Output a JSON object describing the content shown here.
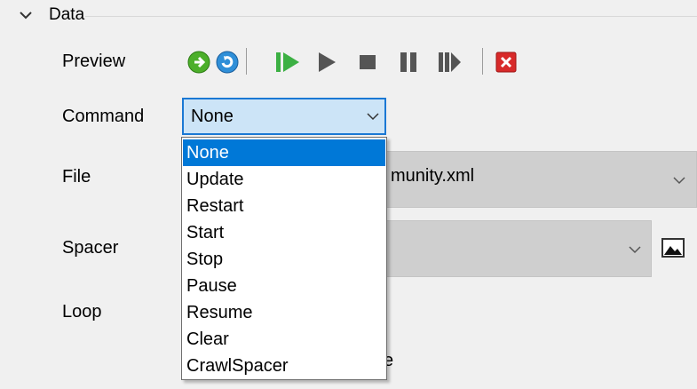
{
  "section": {
    "title": "Data",
    "expand_icon": "chevron-down-icon"
  },
  "labels": {
    "preview": "Preview",
    "command": "Command",
    "file": "File",
    "spacer": "Spacer",
    "loop": "Loop"
  },
  "toolbar": {
    "icons": [
      "go-green-icon",
      "loop-blue-icon",
      "play-green-icon",
      "play-icon",
      "stop-icon",
      "pause-icon",
      "resume-icon",
      "close-red-icon"
    ]
  },
  "command": {
    "value": "None",
    "options": [
      "None",
      "Update",
      "Restart",
      "Start",
      "Stop",
      "Pause",
      "Resume",
      "Clear",
      "CrawlSpacer"
    ],
    "selected_index": 0
  },
  "file": {
    "value_partial": "munity.xml"
  },
  "spacer": {
    "image_button_icon": "image-icon"
  },
  "partially_hidden_text": "e",
  "colors": {
    "accent": "#0078d7",
    "combo_bg": "#cce4f7",
    "field_bg": "#cfcfcf"
  }
}
